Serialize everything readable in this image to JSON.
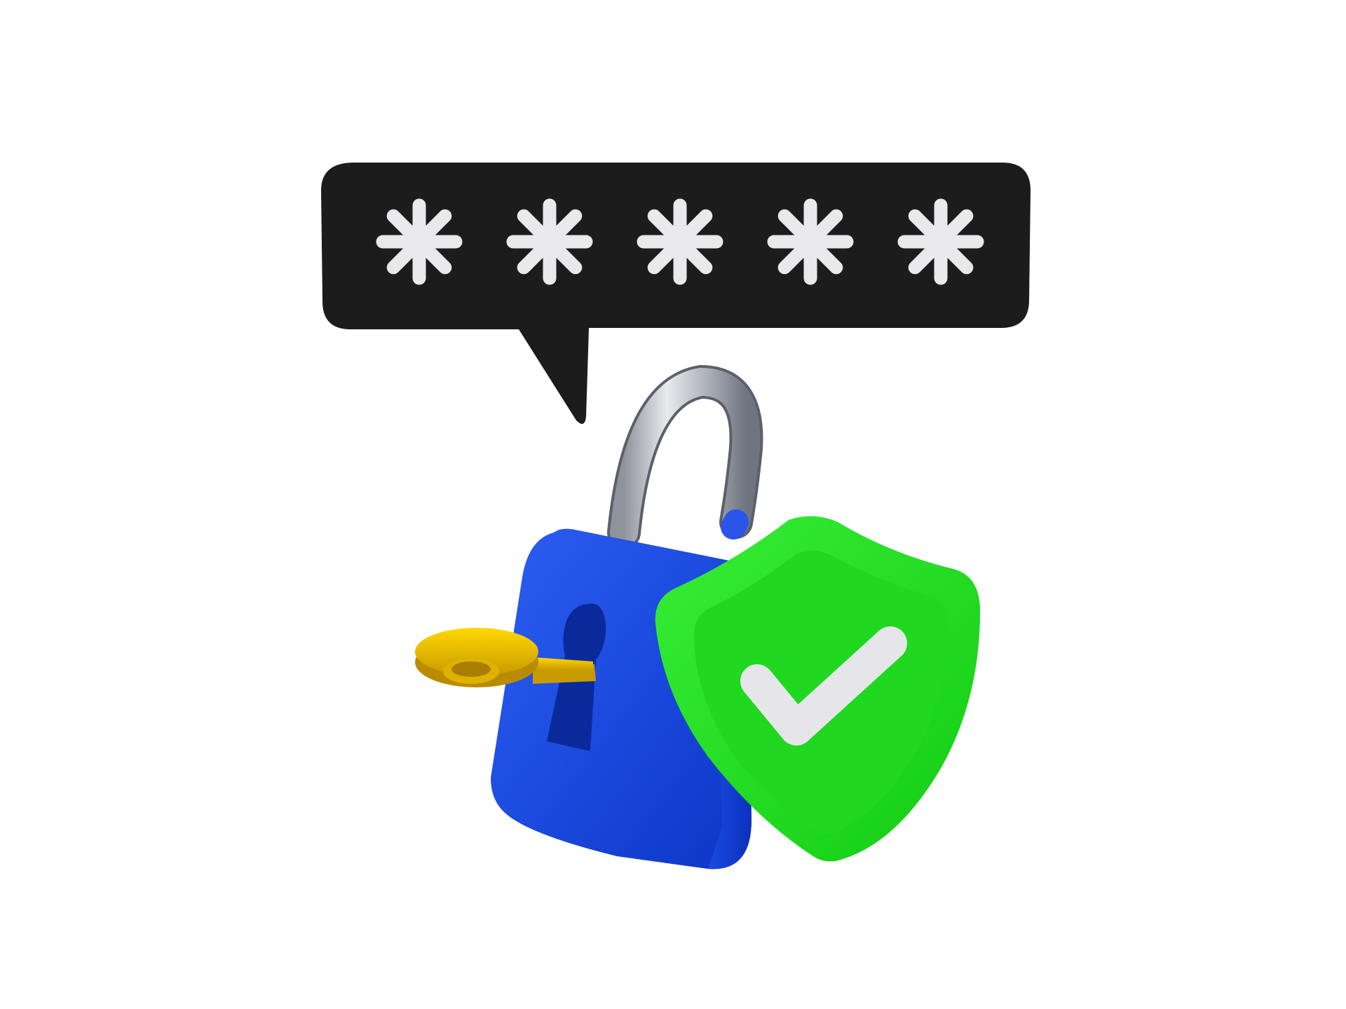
{
  "scene": {
    "background": "#ffffff",
    "bubble": {
      "color": "#1c1c1c",
      "masked_glyph_color": "#e9e9ec",
      "masked_char_count": 5
    },
    "padlock": {
      "state": "unlocked",
      "body_color": "#1f4fe0",
      "shackle_color": "#b9bcc4",
      "keyhole_color": "#0a2a9c",
      "icon": "padlock-icon"
    },
    "key": {
      "color": "#f2c400",
      "icon": "key-icon"
    },
    "shield": {
      "color": "#22dd22",
      "check_color": "#e6e6ea",
      "icon": "shield-check-icon"
    }
  }
}
